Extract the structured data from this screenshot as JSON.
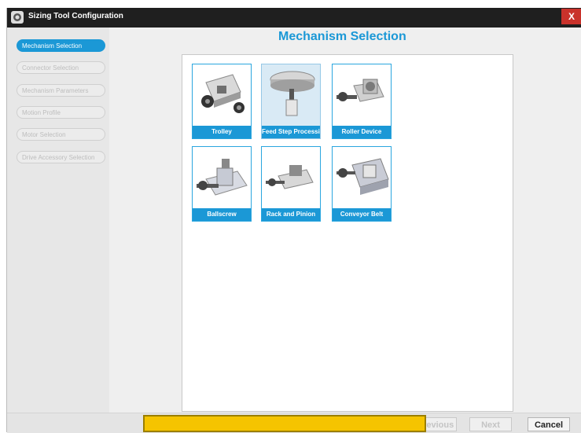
{
  "window": {
    "title": "Sizing Tool Configuration",
    "close_label": "X"
  },
  "sidebar": {
    "items": [
      {
        "label": "Mechanism Selection",
        "active": true
      },
      {
        "label": "Connector Selection",
        "active": false
      },
      {
        "label": "Mechanism Parameters",
        "active": false
      },
      {
        "label": "Motion Profile",
        "active": false
      },
      {
        "label": "Motor Selection",
        "active": false
      },
      {
        "label": "Drive Accessory Selection",
        "active": false
      }
    ]
  },
  "main": {
    "heading": "Mechanism Selection",
    "mechanisms": [
      {
        "label": "Trolley",
        "icon": "trolley-icon",
        "selected": false
      },
      {
        "label": "Feed Step Processing",
        "icon": "feed-step-icon",
        "selected": true
      },
      {
        "label": "Roller Device",
        "icon": "roller-device-icon",
        "selected": false
      },
      {
        "label": "Ballscrew",
        "icon": "ballscrew-icon",
        "selected": false
      },
      {
        "label": "Rack and Pinion",
        "icon": "rack-pinion-icon",
        "selected": false
      },
      {
        "label": "Conveyor Belt",
        "icon": "conveyor-belt-icon",
        "selected": false
      }
    ]
  },
  "footer": {
    "previous_label": "Previous",
    "next_label": "Next",
    "cancel_label": "Cancel"
  },
  "colors": {
    "accent": "#1b98d6",
    "titlebar": "#1f1f1f",
    "close": "#c9322b",
    "overlay": "#f5c400"
  }
}
